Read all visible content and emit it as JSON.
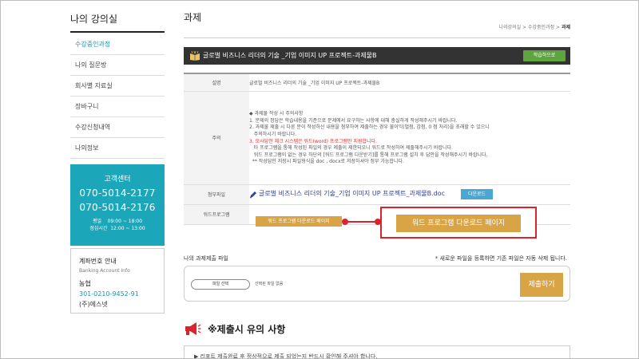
{
  "sidebar": {
    "title": "나의 강의실",
    "items": [
      {
        "label": "수강중인과정"
      },
      {
        "label": "나의 질문방"
      },
      {
        "label": "회사별 자료실"
      },
      {
        "label": "장바구니"
      },
      {
        "label": "수강신청내역"
      },
      {
        "label": "나의정보"
      }
    ],
    "customer_center": {
      "title": "고객센터",
      "phone1": "070-5014-2177",
      "phone2": "070-5014-2176",
      "weekday_label": "평일",
      "weekday_hours": "09:00 ~ 18:00",
      "lunch_label": "점심시간",
      "lunch_hours": "12:00 ~ 13:00"
    },
    "bank": {
      "title": "계좌번호 안내",
      "subtitle": "Banking Account Info",
      "bank_name": "농협",
      "account": "301-0210-9452-91",
      "owner": "(주)에스넷"
    }
  },
  "main": {
    "page_title": "과제",
    "breadcrumb": {
      "part1": "나의강의실",
      "sep": " > ",
      "part2": "수강중인과정",
      "current": "과제"
    },
    "course_title": "글로벌 비즈니스 리더의 기술 _기업 이미지 UP 프로젝트-과제물B",
    "study_button": "학습하으로",
    "rows": {
      "desc_label": "설명",
      "desc_value": "글로벌 비즈니스 리더의 기술 _기업 이미지 UP 프로젝트-과제물B",
      "notice_label": "주의",
      "notice_lines": [
        "◆ 과제물 작성 시 주의사항",
        "1. 문제의 정답은 학습내용을 기준으로 문제에서 요구하는 사항에 대해 충실하게 작성해주시기 바랍니다.",
        "2. 과제물 제출 시 다른 분이 작성하신 내용을 첨부하여 제출하는 경우 불이익(벌점, 감점, 0 점 처리)을 초래할 수 있으니",
        "   주의하시기 바랍니다.",
        "3. 모사답안 체크 시스템은 워드(word) 프로그램만 지원합니다.",
        "   타 프로그램을 통해 작성된 파일의 경우 제출이 제한되오니 워드로 작성하여 제출해주시기 바랍니다.",
        "   워드 프로그램이 없는 경우 하단의 [워드 프로그램 다운받기]를 통해 프로그램 설치 후 답안을 작성해주시기 바랍니다.",
        "  ** 작성답안 저장시 파일형식을 doc , docx로 저장하셔야 정부 가능합니다."
      ],
      "attach_label": "첨부파일",
      "attach_file": "글로벌 비즈니스 리더의 기술_기업 이미지 UP 프로젝트_과제물B.doc",
      "download_button": "다운로드",
      "word_label": "워드프로그램",
      "word_button": "워드 프로그램 다운로드 페이지",
      "word_button_zoom": "워드 프로그램 다운로드 페이지"
    },
    "upload": {
      "label": "나의 과제제출 파일",
      "note": "* 새로운 파일을 등록하면 기존 파일은 자동 삭제 됩니다.",
      "choose_button": "파일 선택",
      "no_file": "선택된 파일 없음",
      "submit_button": "제출하기"
    },
    "caution": {
      "title": "※제출시 유의 사항",
      "line1": "▶ 리포트 제출완료 후 정상적으로 제출 되었는지 반드시 확인해 주셔야 합니다."
    }
  },
  "colors": {
    "accent_teal": "#1ca6b9",
    "gold_button": "#d9a445",
    "green_button": "#5fa53f",
    "blue_button": "#4aa7d4",
    "callout_red": "#d9232f"
  }
}
